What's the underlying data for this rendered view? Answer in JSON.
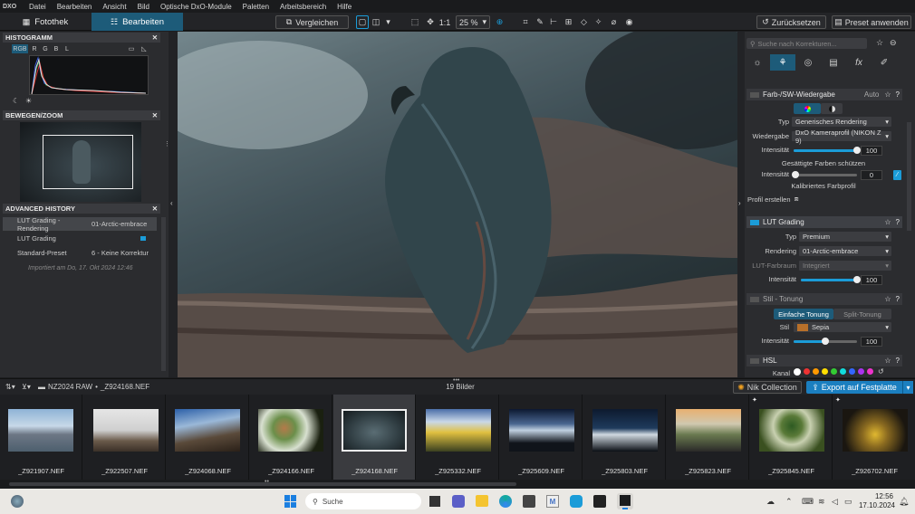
{
  "app": {
    "logo": "DXO"
  },
  "menu": [
    "Datei",
    "Bearbeiten",
    "Ansicht",
    "Bild",
    "Optische DxO-Module",
    "Paletten",
    "Arbeitsbereich",
    "Hilfe"
  ],
  "tabs": {
    "fotothek": "Fotothek",
    "bearbeiten": "Bearbeiten"
  },
  "toolbar": {
    "compare": "Vergleichen",
    "zoom_1_1": "1:1",
    "zoom": "25 %",
    "reset": "Zurücksetzen",
    "preset": "Preset anwenden"
  },
  "left": {
    "histogram": {
      "title": "HISTOGRAMM",
      "channels": [
        "RGB",
        "R",
        "G",
        "B",
        "L"
      ]
    },
    "move_zoom": {
      "title": "BEWEGEN/ZOOM"
    },
    "history": {
      "title": "ADVANCED HISTORY",
      "rows": [
        {
          "name": "LUT Grading - Rendering",
          "value": "01-Arctic-embrace"
        },
        {
          "name": "LUT Grading",
          "value": ""
        },
        {
          "name": "Standard-Preset",
          "value": "6 - Keine Korrektur"
        }
      ],
      "imported": "Importiert am Do, 17. Okt 2024 12:46"
    }
  },
  "right": {
    "search_placeholder": "Suche nach Korrekturen...",
    "color_render": {
      "title": "Farb-/SW-Wiedergabe",
      "auto": "Auto",
      "type_label": "Typ",
      "type_value": "Generisches Rendering",
      "render_label": "Wiedergabe",
      "render_value": "DxO Kameraprofil (NIKON Z 9)",
      "intensity_label": "Intensität",
      "intensity": 100,
      "protect_label": "Gesättigte Farben schützen",
      "protect_intensity_label": "Intensität",
      "protect_value": 0,
      "calibrated": "Kalibriertes Farbprofil",
      "profile_create": "Profil erstellen"
    },
    "lut": {
      "title": "LUT Grading",
      "type_label": "Typ",
      "type_value": "Premium",
      "render_label": "Rendering",
      "render_value": "01-Arctic-embrace",
      "space_label": "LUT-Farbraum",
      "space_value": "Integriert",
      "intensity_label": "Intensität",
      "intensity": 100
    },
    "toning": {
      "title": "Stil - Tonung",
      "tab1": "Einfache Tonung",
      "tab2": "Split-Tonung",
      "style_label": "Stil",
      "style_value": "Sepia",
      "intensity_label": "Intensität",
      "intensity": 100
    },
    "hsl": {
      "title": "HSL",
      "channel_label": "Kanal"
    }
  },
  "film": {
    "path_root": "NZ2024 RAW",
    "path_file": "_Z924168.NEF",
    "count": "19 Bilder",
    "nik": "Nik Collection",
    "export": "Export auf Festplatte",
    "thumbs": [
      "_Z921907.NEF",
      "_Z922507.NEF",
      "_Z924068.NEF",
      "_Z924166.NEF",
      "_Z924168.NEF",
      "_Z925332.NEF",
      "_Z925609.NEF",
      "_Z925803.NEF",
      "_Z925823.NEF",
      "_Z925845.NEF",
      "_Z926702.NEF"
    ]
  },
  "taskbar": {
    "search": "Suche",
    "time": "12:56",
    "date": "17.10.2024"
  }
}
